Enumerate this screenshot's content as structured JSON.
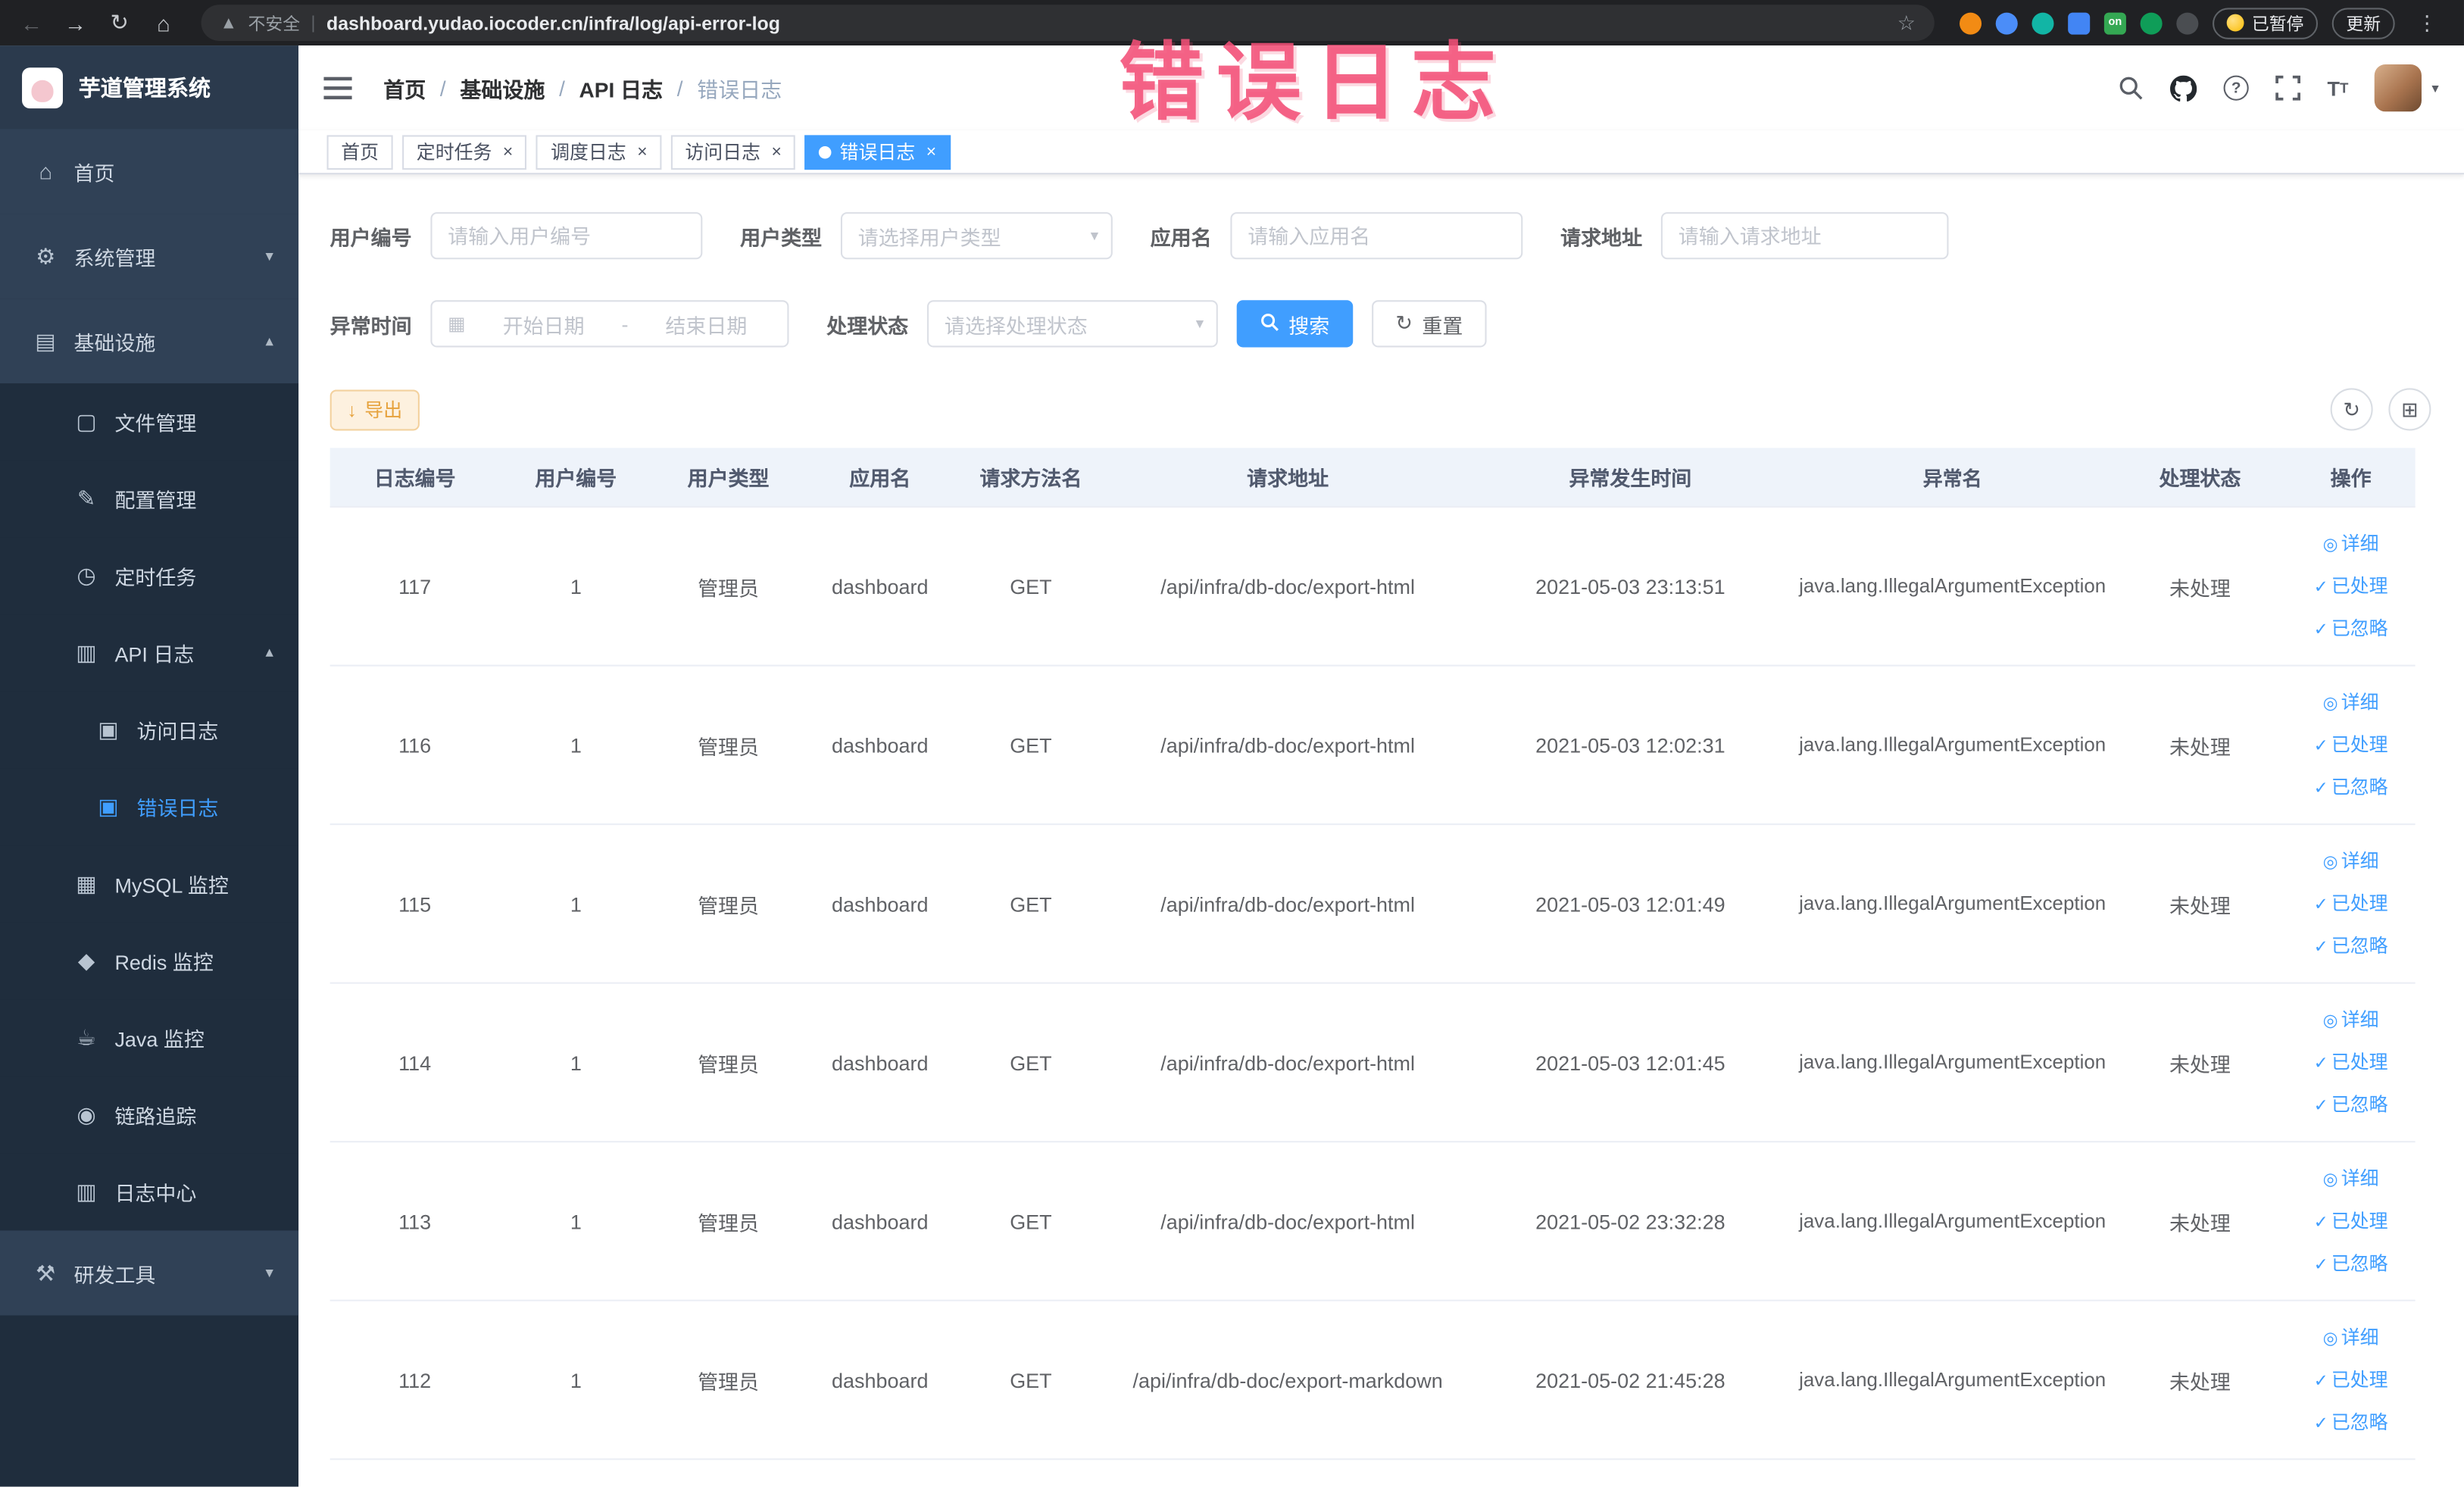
{
  "colors": {
    "accent": "#409eff",
    "warning": "#e6a23c",
    "annotation": "#f05078",
    "sidebar_bg": "#304156",
    "submenu_bg": "#1f2d3d"
  },
  "annotation": {
    "text": "错误日志"
  },
  "browser": {
    "security_label": "不安全",
    "url": "dashboard.yudao.iocoder.cn/infra/log/api-error-log",
    "paused_label": "已暂停",
    "update_label": "更新",
    "extensions": [
      {
        "key": "orange",
        "color": "#f28b14"
      },
      {
        "key": "blue",
        "color": "#4b8df8"
      },
      {
        "key": "teal",
        "color": "#12b5a5"
      },
      {
        "key": "grid",
        "color": "#4285f4",
        "square": true
      },
      {
        "key": "on-badge",
        "color": "#34a853",
        "square": true,
        "label": "on"
      },
      {
        "key": "leaf",
        "color": "#0f9d58"
      },
      {
        "key": "paw",
        "color": "#4a4d51"
      }
    ]
  },
  "sidebar": {
    "logo_title": "芋道管理系统",
    "menu": [
      {
        "key": "home",
        "label": "首页",
        "icon": "home",
        "level": 1
      },
      {
        "key": "system",
        "label": "系统管理",
        "icon": "gear",
        "level": 1,
        "arrow": "down"
      },
      {
        "key": "infra",
        "label": "基础设施",
        "icon": "infra",
        "level": 1,
        "arrow": "up"
      },
      {
        "key": "file",
        "label": "文件管理",
        "icon": "file",
        "level": 2
      },
      {
        "key": "config",
        "label": "配置管理",
        "icon": "config",
        "level": 2
      },
      {
        "key": "job",
        "label": "定时任务",
        "icon": "timer",
        "level": 2
      },
      {
        "key": "api-log",
        "label": "API 日志",
        "icon": "apilog",
        "level": 2,
        "arrow": "up"
      },
      {
        "key": "access-log",
        "label": "访问日志",
        "icon": "doc",
        "level": 3
      },
      {
        "key": "error-log",
        "label": "错误日志",
        "icon": "doc",
        "level": 3,
        "active": true
      },
      {
        "key": "mysql",
        "label": "MySQL 监控",
        "icon": "mysql",
        "level": 2
      },
      {
        "key": "redis",
        "label": "Redis 监控",
        "icon": "redis",
        "level": 2
      },
      {
        "key": "java",
        "label": "Java 监控",
        "icon": "java",
        "level": 2
      },
      {
        "key": "trace",
        "label": "链路追踪",
        "icon": "trace",
        "level": 2
      },
      {
        "key": "log-center",
        "label": "日志中心",
        "icon": "logcenter",
        "level": 2
      },
      {
        "key": "dev-tools",
        "label": "研发工具",
        "icon": "tool",
        "level": 1,
        "arrow": "down"
      }
    ]
  },
  "breadcrumb": [
    {
      "key": "home",
      "label": "首页"
    },
    {
      "key": "infra",
      "label": "基础设施"
    },
    {
      "key": "api-log",
      "label": "API 日志"
    },
    {
      "key": "error-log",
      "label": "错误日志"
    }
  ],
  "tabs": [
    {
      "key": "home",
      "label": "首页"
    },
    {
      "key": "job",
      "label": "定时任务",
      "closable": true
    },
    {
      "key": "job-log",
      "label": "调度日志",
      "closable": true
    },
    {
      "key": "access-log",
      "label": "访问日志",
      "closable": true
    },
    {
      "key": "error-log",
      "label": "错误日志",
      "closable": true,
      "active": true
    }
  ],
  "filters": {
    "user_id_label": "用户编号",
    "user_id_placeholder": "请输入用户编号",
    "user_type_label": "用户类型",
    "user_type_placeholder": "请选择用户类型",
    "app_name_label": "应用名",
    "app_name_placeholder": "请输入应用名",
    "request_url_label": "请求地址",
    "request_url_placeholder": "请输入请求地址",
    "exception_time_label": "异常时间",
    "start_date_placeholder": "开始日期",
    "range_separator": "-",
    "end_date_placeholder": "结束日期",
    "process_status_label": "处理状态",
    "process_status_placeholder": "请选择处理状态",
    "search_label": "搜索",
    "reset_label": "重置"
  },
  "toolbar": {
    "export_label": "导出"
  },
  "table": {
    "headers": [
      "日志编号",
      "用户编号",
      "用户类型",
      "应用名",
      "请求方法名",
      "请求地址",
      "异常发生时间",
      "异常名",
      "处理状态",
      "操作"
    ],
    "actions": [
      "详细",
      "已处理",
      "已忽略"
    ],
    "rows": [
      {
        "id": "117",
        "user_id": "1",
        "user_type": "管理员",
        "app": "dashboard",
        "method": "GET",
        "url": "/api/infra/db-doc/export-html",
        "time": "2021-05-03 23:13:51",
        "exception": "java.lang.IllegalArgumentException",
        "status": "未处理"
      },
      {
        "id": "116",
        "user_id": "1",
        "user_type": "管理员",
        "app": "dashboard",
        "method": "GET",
        "url": "/api/infra/db-doc/export-html",
        "time": "2021-05-03 12:02:31",
        "exception": "java.lang.IllegalArgumentException",
        "status": "未处理"
      },
      {
        "id": "115",
        "user_id": "1",
        "user_type": "管理员",
        "app": "dashboard",
        "method": "GET",
        "url": "/api/infra/db-doc/export-html",
        "time": "2021-05-03 12:01:49",
        "exception": "java.lang.IllegalArgumentException",
        "status": "未处理"
      },
      {
        "id": "114",
        "user_id": "1",
        "user_type": "管理员",
        "app": "dashboard",
        "method": "GET",
        "url": "/api/infra/db-doc/export-html",
        "time": "2021-05-03 12:01:45",
        "exception": "java.lang.IllegalArgumentException",
        "status": "未处理"
      },
      {
        "id": "113",
        "user_id": "1",
        "user_type": "管理员",
        "app": "dashboard",
        "method": "GET",
        "url": "/api/infra/db-doc/export-html",
        "time": "2021-05-02 23:32:28",
        "exception": "java.lang.IllegalArgumentException",
        "status": "未处理"
      },
      {
        "id": "112",
        "user_id": "1",
        "user_type": "管理员",
        "app": "dashboard",
        "method": "GET",
        "url": "/api/infra/db-doc/export-markdown",
        "time": "2021-05-02 21:45:28",
        "exception": "java.lang.IllegalArgumentException",
        "status": "未处理"
      }
    ]
  }
}
